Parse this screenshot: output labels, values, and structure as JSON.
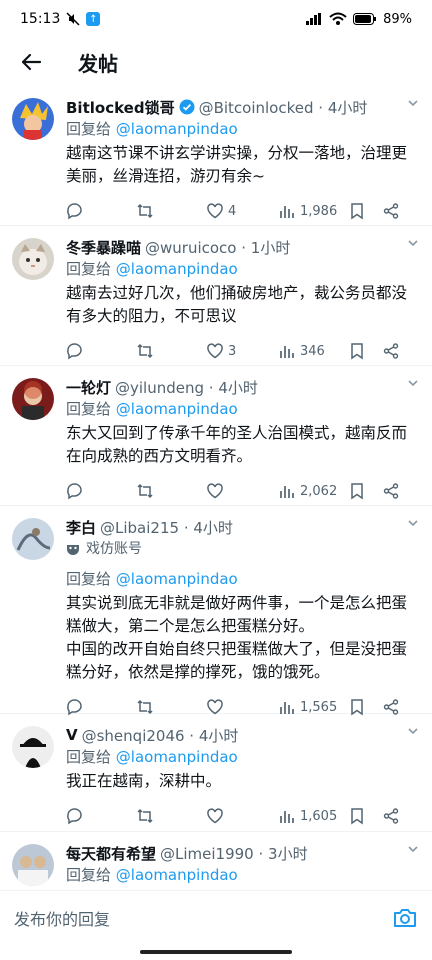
{
  "status_bar": {
    "time": "15:13",
    "battery": "89%"
  },
  "header": {
    "title": "发帖"
  },
  "tweets": [
    {
      "name": "Bitlocked锁哥",
      "handle": "@Bitcoinlocked · 4小时",
      "reply_prefix": "回复给 ",
      "reply_mention": "@laomanpindao",
      "content": [
        "越南这节课不讲玄学讲实操，分权一落地，治理更美丽，丝滑连招，游刃有余~"
      ],
      "likes": "4",
      "views": "1,986",
      "verified": true
    },
    {
      "name": "冬季暴躁喵",
      "handle": "@wuruicoco · 1小时",
      "reply_prefix": "回复给 ",
      "reply_mention": "@laomanpindao",
      "content": [
        "越南去过好几次，他们捅破房地产，裁公务员都没有多大的阻力，不可思议"
      ],
      "likes": "3",
      "views": "346"
    },
    {
      "name": "一轮灯",
      "handle": "@yilundeng · 4小时",
      "reply_prefix": "回复给 ",
      "reply_mention": "@laomanpindao",
      "content": [
        "东大又回到了传承千年的圣人治国模式，越南反而在向成熟的西方文明看齐。"
      ],
      "likes": "",
      "views": "2,062"
    },
    {
      "name": "李白",
      "handle": "@Libai215 · 4小时",
      "badge": "戏仿账号",
      "reply_prefix": "回复给 ",
      "reply_mention": "@laomanpindao",
      "content": [
        "其实说到底无非就是做好两件事，一个是怎么把蛋糕做大，第二个是怎么把蛋糕分好。",
        "中国的改开自始自终只把蛋糕做大了，但是没把蛋糕分好，依然是撑的撑死，饿的饿死。"
      ],
      "likes": "",
      "views": "1,565"
    },
    {
      "name": "V",
      "handle": "@shenqi2046 · 4小时",
      "reply_prefix": "回复给 ",
      "reply_mention": "@laomanpindao",
      "content": [
        "我正在越南，深耕中。"
      ],
      "likes": "",
      "views": "1,605"
    },
    {
      "name": "每天都有希望",
      "handle": "@Limei1990 · 3小时",
      "reply_prefix": "回复给 ",
      "reply_mention": "@laomanpindao",
      "content": [],
      "likes": "",
      "views": ""
    }
  ],
  "compose": {
    "placeholder": "发布你的回复"
  },
  "colors": {
    "accent": "#1d9bf0",
    "text": "#0f1419",
    "muted": "#536471",
    "divider": "#eff3f4"
  }
}
